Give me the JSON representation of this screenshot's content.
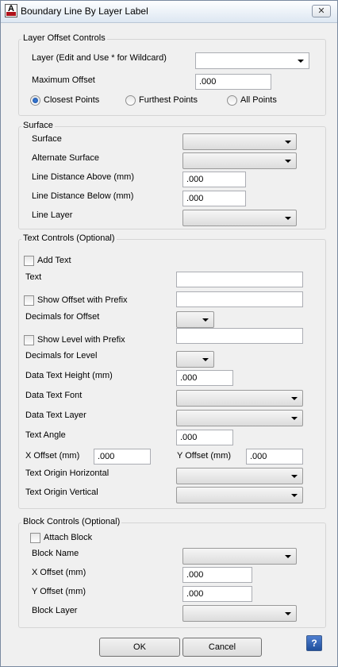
{
  "window": {
    "title": "Boundary Line By Layer Label",
    "close_glyph": "✕",
    "app_icon_letter": "A",
    "app_icon": "autocad-app-icon",
    "help_icon": "help-icon"
  },
  "layer_offset": {
    "legend": "Layer  Offset Controls",
    "layer_label": "Layer (Edit and Use * for Wildcard)",
    "layer_value": "",
    "max_offset_label": "Maximum Offset",
    "max_offset_value": ".000",
    "radio": [
      {
        "label": "Closest Points",
        "selected": true
      },
      {
        "label": "Furthest Points",
        "selected": false
      },
      {
        "label": "All Points",
        "selected": false
      }
    ]
  },
  "surface": {
    "legend": "Surface",
    "surface_label": "Surface",
    "alt_surface_label": "Alternate Surface",
    "dist_above_label": "Line Distance Above (mm)",
    "dist_above_value": ".000",
    "dist_below_label": "Line Distance Below (mm)",
    "dist_below_value": ".000",
    "line_layer_label": "Line Layer"
  },
  "text_controls": {
    "legend": "Text Controls (Optional)",
    "add_text_label": "Add Text",
    "text_label": "Text",
    "text_value": "",
    "show_offset_label": "Show Offset with Prefix",
    "show_offset_value": "",
    "decimals_offset_label": "Decimals for Offset",
    "show_level_label": "Show Level with Prefix",
    "show_level_value": "",
    "decimals_level_label": "Decimals for Level",
    "data_text_height_label": "Data Text Height (mm)",
    "data_text_height_value": ".000",
    "data_text_font_label": "Data Text Font",
    "data_text_layer_label": "Data Text Layer",
    "text_angle_label": "Text Angle",
    "text_angle_value": ".000",
    "x_offset_label": "X Offset (mm)",
    "x_offset_value": ".000",
    "y_offset_label": "Y Offset (mm)",
    "y_offset_value": ".000",
    "origin_h_label": "Text Origin Horizontal",
    "origin_v_label": "Text Origin Vertical"
  },
  "block_controls": {
    "legend": "Block Controls (Optional)",
    "attach_label": "Attach Block",
    "block_name_label": "Block Name",
    "x_offset_label": "X Offset (mm)",
    "x_offset_value": ".000",
    "y_offset_label": "Y Offset (mm)",
    "y_offset_value": ".000",
    "block_layer_label": "Block Layer"
  },
  "buttons": {
    "ok": "OK",
    "cancel": "Cancel",
    "help": "?"
  }
}
